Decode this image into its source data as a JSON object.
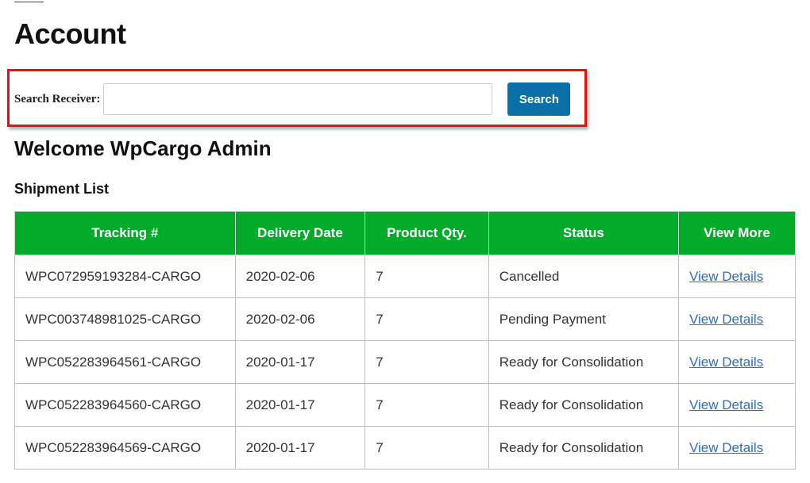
{
  "page": {
    "title": "Account"
  },
  "search": {
    "label": "Search Receiver:",
    "value": "",
    "placeholder": "",
    "button_label": "Search"
  },
  "welcome": "Welcome WpCargo Admin",
  "shipment_list": {
    "heading": "Shipment List",
    "columns": [
      "Tracking #",
      "Delivery Date",
      "Product Qty.",
      "Status",
      "View More"
    ],
    "rows": [
      {
        "tracking": "WPC072959193284-CARGO",
        "delivery_date": "2020-02-06",
        "qty": "7",
        "status": "Cancelled",
        "view": "View Details"
      },
      {
        "tracking": "WPC003748981025-CARGO",
        "delivery_date": "2020-02-06",
        "qty": "7",
        "status": "Pending Payment",
        "view": "View Details"
      },
      {
        "tracking": "WPC052283964561-CARGO",
        "delivery_date": "2020-01-17",
        "qty": "7",
        "status": "Ready for Consolidation",
        "view": "View Details"
      },
      {
        "tracking": "WPC052283964560-CARGO",
        "delivery_date": "2020-01-17",
        "qty": "7",
        "status": "Ready for Consolidation",
        "view": "View Details"
      },
      {
        "tracking": "WPC052283964569-CARGO",
        "delivery_date": "2020-01-17",
        "qty": "7",
        "status": "Ready for Consolidation",
        "view": "View Details"
      }
    ]
  },
  "colors": {
    "header_green": "#02ac2a",
    "search_button_blue": "#0b6fa8",
    "highlight_red": "#e01414",
    "link_blue": "#2b6ec2"
  }
}
